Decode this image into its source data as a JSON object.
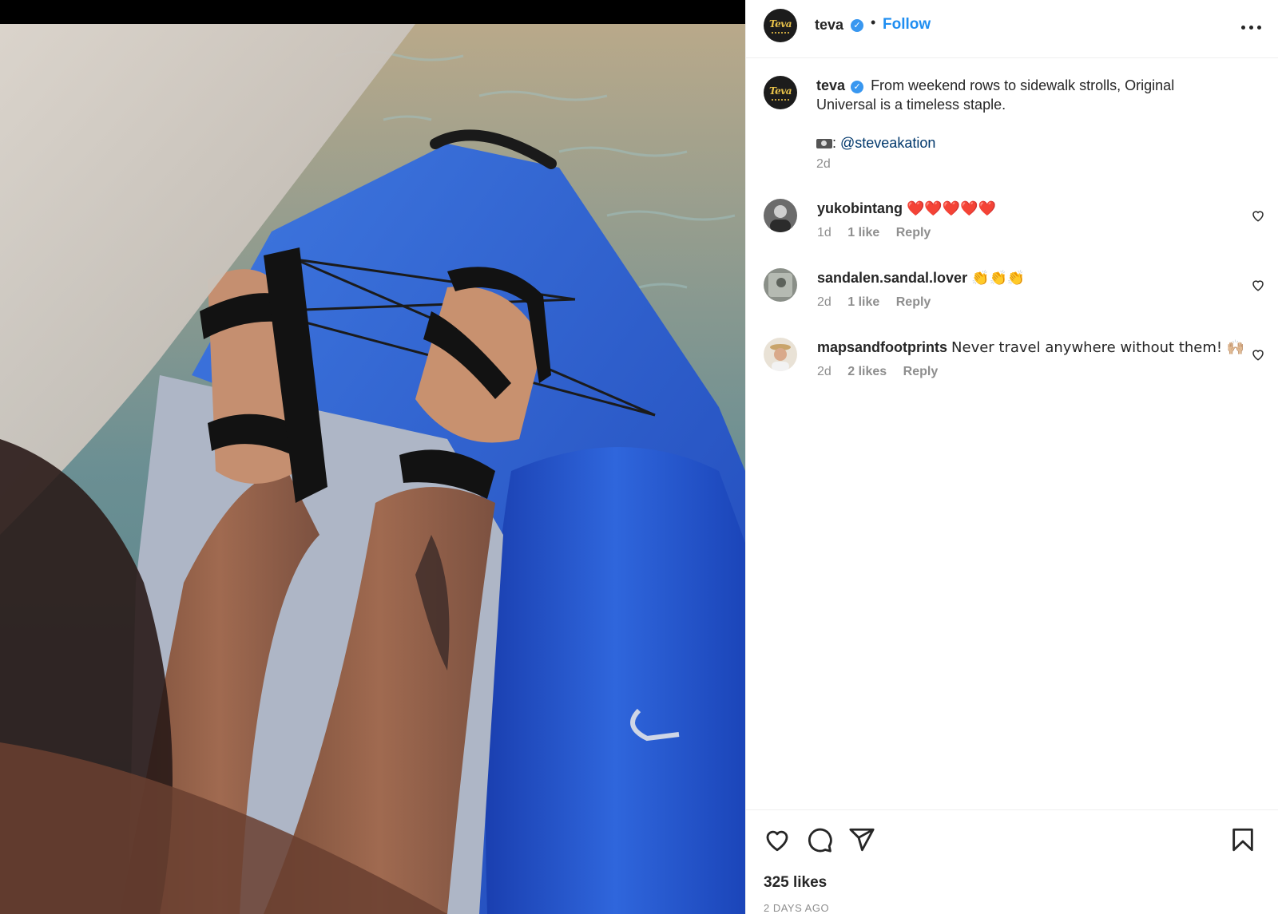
{
  "post": {
    "username": "teva",
    "verified_glyph": "✓",
    "separator": "•",
    "follow_label": "Follow",
    "avatar_logo_text": "Teva",
    "photo_description": "Feet in black sport sandals resting on a blue kayak over water"
  },
  "caption": {
    "username": "teva",
    "line1": "From weekend rows to sidewalk strolls, Original Universal is a timeless staple.",
    "credit_prefix": ": ",
    "credit_mention": "@steveakation",
    "time": "2d"
  },
  "comments": [
    {
      "username": "yukobintang",
      "text": "❤️❤️❤️❤️❤️",
      "time": "1d",
      "likes": "1 like",
      "reply": "Reply"
    },
    {
      "username": "sandalen.sandal.lover",
      "text": "👏👏👏",
      "time": "2d",
      "likes": "1 like",
      "reply": "Reply"
    },
    {
      "username": "mapsandfootprints",
      "text": "Never travel anywhere without them! 🙌🏼",
      "time": "2d",
      "likes": "2 likes",
      "reply": "Reply"
    }
  ],
  "footer": {
    "likes": "325 likes",
    "date": "2 DAYS AGO"
  },
  "icons": {
    "like": "heart-icon",
    "comment": "comment-icon",
    "share": "share-icon",
    "save": "bookmark-icon",
    "more": "more-icon"
  },
  "colors": {
    "accent": "#1f8ef1",
    "verified": "#3897f0",
    "kayak": "#2d5fd6",
    "heart_red": "#e0245e"
  }
}
